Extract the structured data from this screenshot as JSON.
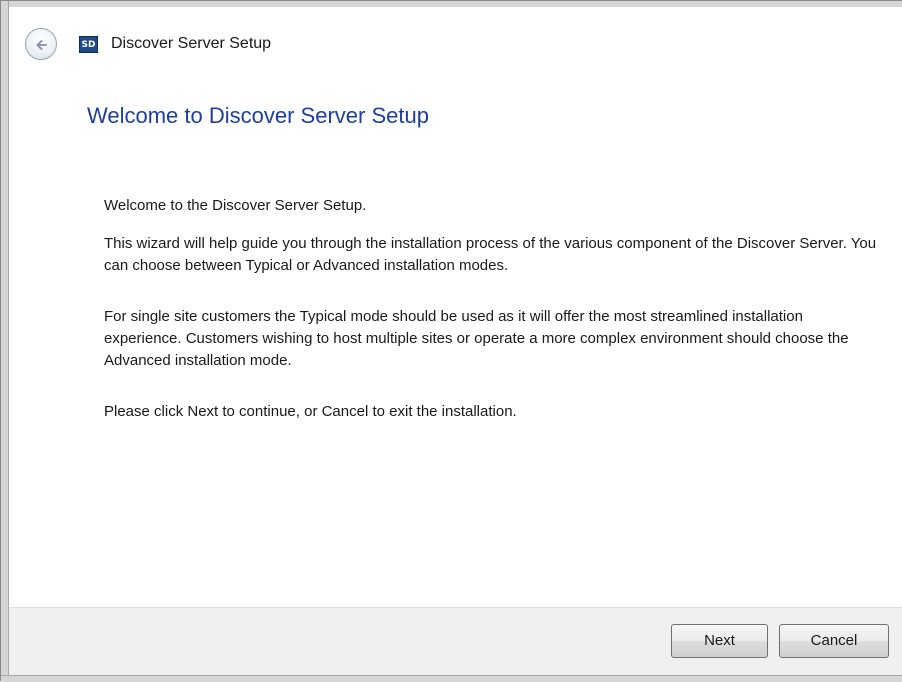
{
  "window": {
    "title": "Discover Server Setup",
    "app_icon_text": "SD"
  },
  "main": {
    "heading": "Welcome to Discover Server Setup",
    "paragraphs": [
      "Welcome to the Discover Server Setup.",
      "This wizard will help guide you through the installation process of the various component of the Discover Server. You can choose between Typical or Advanced installation modes.",
      "For single site customers the Typical mode should be used as it will offer the most streamlined installation experience. Customers wishing to host multiple sites or operate a more complex environment should choose the Advanced installation mode.",
      "Please click Next to continue, or Cancel to exit the installation."
    ]
  },
  "footer": {
    "next_label": "Next",
    "cancel_label": "Cancel"
  },
  "icons": {
    "back": "back-arrow-icon",
    "app": "app-icon"
  },
  "colors": {
    "heading": "#1e3f9e",
    "app_icon_bg": "#1f4a86",
    "footer_bg": "#f0f0f0"
  }
}
